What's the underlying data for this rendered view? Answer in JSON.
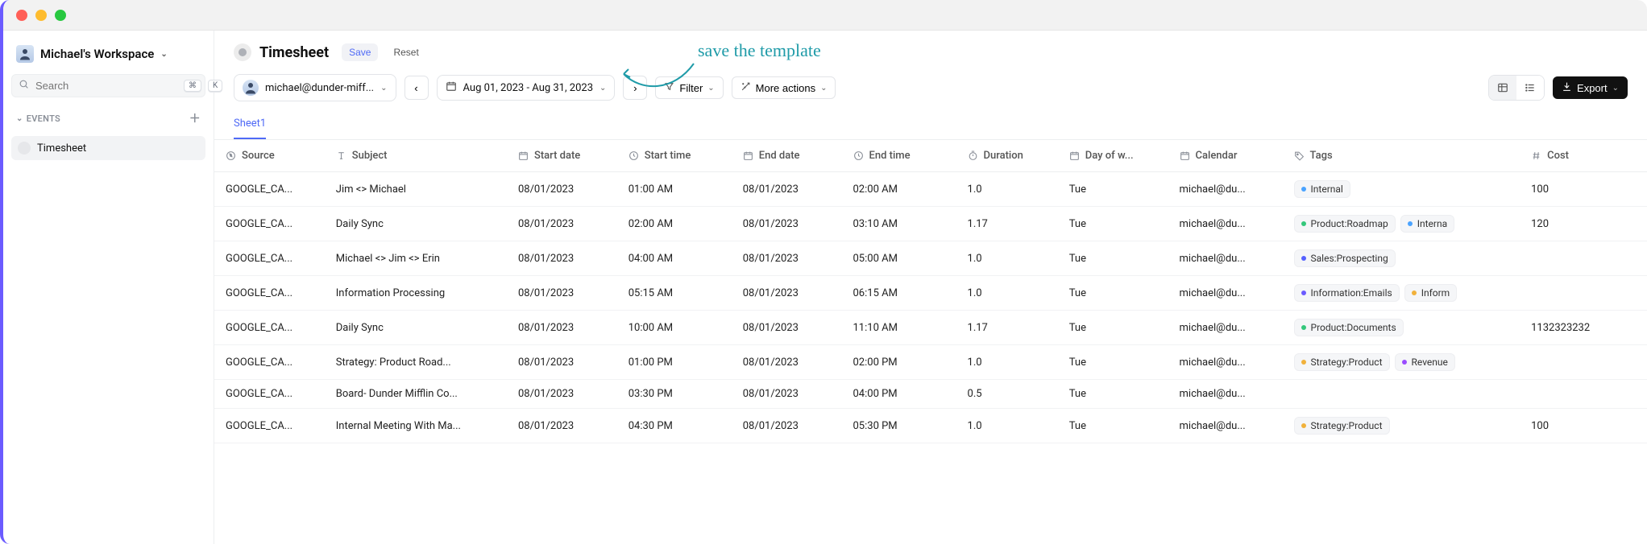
{
  "workspace": {
    "name": "Michael's Workspace"
  },
  "search": {
    "placeholder": "Search",
    "shortcut_mod": "⌘",
    "shortcut_key": "K"
  },
  "sidebar": {
    "sections": [
      {
        "label": "EVENTS",
        "items": [
          {
            "label": "Timesheet",
            "active": true
          }
        ]
      }
    ]
  },
  "header": {
    "title": "Timesheet",
    "save_label": "Save",
    "reset_label": "Reset"
  },
  "annotation": {
    "text": "save the template"
  },
  "toolbar": {
    "user_email": "michael@dunder-miff...",
    "date_range": "Aug 01, 2023 - Aug 31, 2023",
    "filter_label": "Filter",
    "more_actions_label": "More actions",
    "export_label": "Export"
  },
  "tabs": [
    {
      "label": "Sheet1",
      "active": true
    }
  ],
  "columns": [
    {
      "key": "source",
      "label": "Source",
      "icon": "compass"
    },
    {
      "key": "subject",
      "label": "Subject",
      "icon": "text"
    },
    {
      "key": "start_date",
      "label": "Start date",
      "icon": "calendar"
    },
    {
      "key": "start_time",
      "label": "Start time",
      "icon": "clock"
    },
    {
      "key": "end_date",
      "label": "End date",
      "icon": "calendar"
    },
    {
      "key": "end_time",
      "label": "End time",
      "icon": "clock"
    },
    {
      "key": "duration",
      "label": "Duration",
      "icon": "timer"
    },
    {
      "key": "day_of_week",
      "label": "Day of w...",
      "icon": "calendar"
    },
    {
      "key": "calendar",
      "label": "Calendar",
      "icon": "calendar"
    },
    {
      "key": "tags",
      "label": "Tags",
      "icon": "tag"
    },
    {
      "key": "cost",
      "label": "Cost",
      "icon": "hash"
    }
  ],
  "tag_colors": {
    "Internal": "#4aa3ff",
    "Product:Roadmap": "#34c77b",
    "Interna": "#4aa3ff",
    "Sales:Prospecting": "#5560ff",
    "Information:Emails": "#6b5bff",
    "Inform": "#f1b13b",
    "Product:Documents": "#34c77b",
    "Strategy:Product": "#f1b13b",
    "Revenue": "#9a4dff"
  },
  "rows": [
    {
      "source": "GOOGLE_CA...",
      "subject": "Jim <> Michael",
      "start_date": "08/01/2023",
      "start_time": "01:00 AM",
      "end_date": "08/01/2023",
      "end_time": "02:00 AM",
      "duration": "1.0",
      "day_of_week": "Tue",
      "calendar": "michael@du...",
      "tags": [
        "Internal"
      ],
      "cost": "100"
    },
    {
      "source": "GOOGLE_CA...",
      "subject": "Daily Sync",
      "start_date": "08/01/2023",
      "start_time": "02:00 AM",
      "end_date": "08/01/2023",
      "end_time": "03:10 AM",
      "duration": "1.17",
      "day_of_week": "Tue",
      "calendar": "michael@du...",
      "tags": [
        "Product:Roadmap",
        "Interna"
      ],
      "cost": "120"
    },
    {
      "source": "GOOGLE_CA...",
      "subject": "Michael <> Jim <> Erin",
      "start_date": "08/01/2023",
      "start_time": "04:00 AM",
      "end_date": "08/01/2023",
      "end_time": "05:00 AM",
      "duration": "1.0",
      "day_of_week": "Tue",
      "calendar": "michael@du...",
      "tags": [
        "Sales:Prospecting"
      ],
      "cost": ""
    },
    {
      "source": "GOOGLE_CA...",
      "subject": "Information Processing",
      "start_date": "08/01/2023",
      "start_time": "05:15 AM",
      "end_date": "08/01/2023",
      "end_time": "06:15 AM",
      "duration": "1.0",
      "day_of_week": "Tue",
      "calendar": "michael@du...",
      "tags": [
        "Information:Emails",
        "Inform"
      ],
      "cost": ""
    },
    {
      "source": "GOOGLE_CA...",
      "subject": "Daily Sync",
      "start_date": "08/01/2023",
      "start_time": "10:00 AM",
      "end_date": "08/01/2023",
      "end_time": "11:10 AM",
      "duration": "1.17",
      "day_of_week": "Tue",
      "calendar": "michael@du...",
      "tags": [
        "Product:Documents"
      ],
      "cost": "1132323232"
    },
    {
      "source": "GOOGLE_CA...",
      "subject": "Strategy: Product Road...",
      "start_date": "08/01/2023",
      "start_time": "01:00 PM",
      "end_date": "08/01/2023",
      "end_time": "02:00 PM",
      "duration": "1.0",
      "day_of_week": "Tue",
      "calendar": "michael@du...",
      "tags": [
        "Strategy:Product",
        "Revenue"
      ],
      "cost": ""
    },
    {
      "source": "GOOGLE_CA...",
      "subject": "Board- Dunder Mifflin Co...",
      "start_date": "08/01/2023",
      "start_time": "03:30 PM",
      "end_date": "08/01/2023",
      "end_time": "04:00 PM",
      "duration": "0.5",
      "day_of_week": "Tue",
      "calendar": "michael@du...",
      "tags": [],
      "cost": ""
    },
    {
      "source": "GOOGLE_CA...",
      "subject": "Internal Meeting With Ma...",
      "start_date": "08/01/2023",
      "start_time": "04:30 PM",
      "end_date": "08/01/2023",
      "end_time": "05:30 PM",
      "duration": "1.0",
      "day_of_week": "Tue",
      "calendar": "michael@du...",
      "tags": [
        "Strategy:Product"
      ],
      "cost": "100"
    }
  ]
}
